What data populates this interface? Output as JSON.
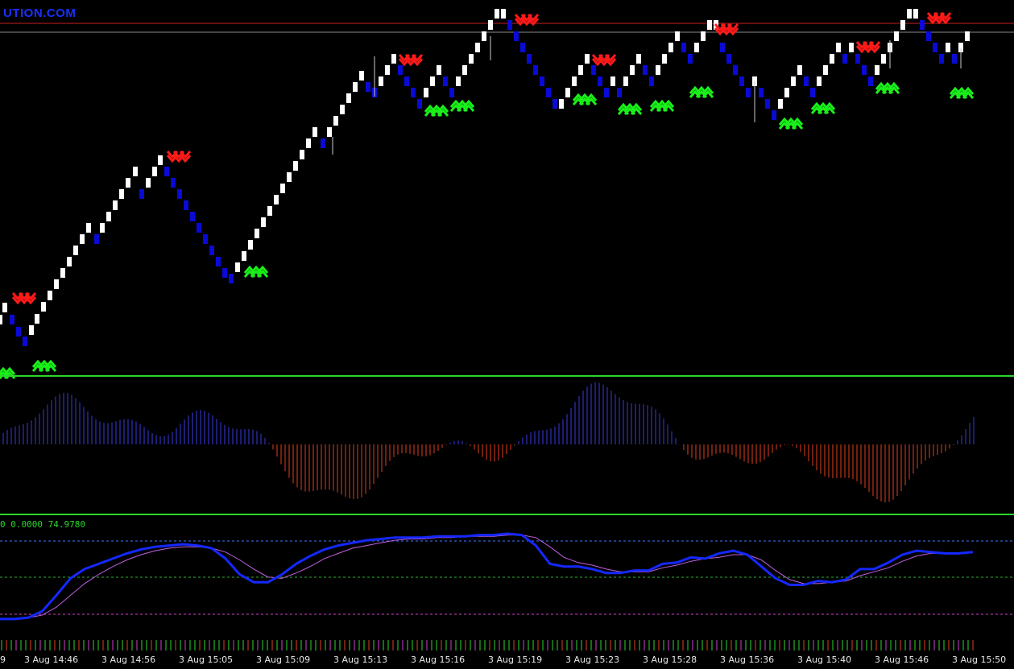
{
  "watermark": "UTION.COM",
  "stochastic": {
    "readout": "0 0.0000 74.9780",
    "main": [
      0.24,
      0.24,
      0.25,
      0.3,
      0.42,
      0.55,
      0.62,
      0.66,
      0.7,
      0.74,
      0.77,
      0.79,
      0.8,
      0.81,
      0.8,
      0.78,
      0.7,
      0.58,
      0.52,
      0.52,
      0.58,
      0.66,
      0.72,
      0.77,
      0.8,
      0.82,
      0.84,
      0.85,
      0.86,
      0.86,
      0.86,
      0.87,
      0.87,
      0.87,
      0.88,
      0.88,
      0.89,
      0.88,
      0.8,
      0.66,
      0.64,
      0.64,
      0.62,
      0.59,
      0.59,
      0.61,
      0.61,
      0.66,
      0.67,
      0.71,
      0.7,
      0.74,
      0.76,
      0.73,
      0.64,
      0.55,
      0.5,
      0.5,
      0.53,
      0.52,
      0.54,
      0.62,
      0.62,
      0.67,
      0.73,
      0.76,
      0.75,
      0.74,
      0.74,
      0.75
    ],
    "signal": [
      0.24,
      0.24,
      0.25,
      0.27,
      0.33,
      0.42,
      0.51,
      0.58,
      0.64,
      0.69,
      0.73,
      0.76,
      0.78,
      0.79,
      0.79,
      0.78,
      0.75,
      0.69,
      0.62,
      0.56,
      0.55,
      0.59,
      0.64,
      0.7,
      0.74,
      0.78,
      0.8,
      0.82,
      0.84,
      0.85,
      0.85,
      0.86,
      0.86,
      0.87,
      0.87,
      0.87,
      0.88,
      0.88,
      0.86,
      0.79,
      0.71,
      0.67,
      0.65,
      0.62,
      0.6,
      0.6,
      0.6,
      0.63,
      0.65,
      0.68,
      0.7,
      0.71,
      0.73,
      0.73,
      0.69,
      0.61,
      0.54,
      0.51,
      0.51,
      0.52,
      0.53,
      0.57,
      0.6,
      0.63,
      0.68,
      0.72,
      0.74,
      0.74,
      0.74,
      0.75
    ]
  },
  "time_axis": {
    "edge": "9",
    "labels": [
      "3 Aug 14:46",
      "3 Aug 14:56",
      "3 Aug 15:05",
      "3 Aug 15:09",
      "3 Aug 15:13",
      "3 Aug 15:16",
      "3 Aug 15:19",
      "3 Aug 15:23",
      "3 Aug 15:28",
      "3 Aug 15:36",
      "3 Aug 15:40",
      "3 Aug 15:46",
      "3 Aug 15:50"
    ]
  },
  "colors": {
    "background": "#000000",
    "bull_brick": "#ffffff",
    "bear_brick": "#0a0ad6",
    "sell_arrow": "#ff1a1a",
    "buy_arrow": "#19f019",
    "separator": "#2bd62b",
    "price_line_red": "#c81e1e",
    "price_line_grey": "#8a8a8a",
    "hist_up": "#3a3ae0",
    "hist_down": "#e0401e",
    "stoch_main": "#1428ff",
    "stoch_signal": "#c060e0",
    "level_high": "#3a78ff",
    "level_mid": "#2bb52b",
    "level_low": "#d040d0"
  }
}
